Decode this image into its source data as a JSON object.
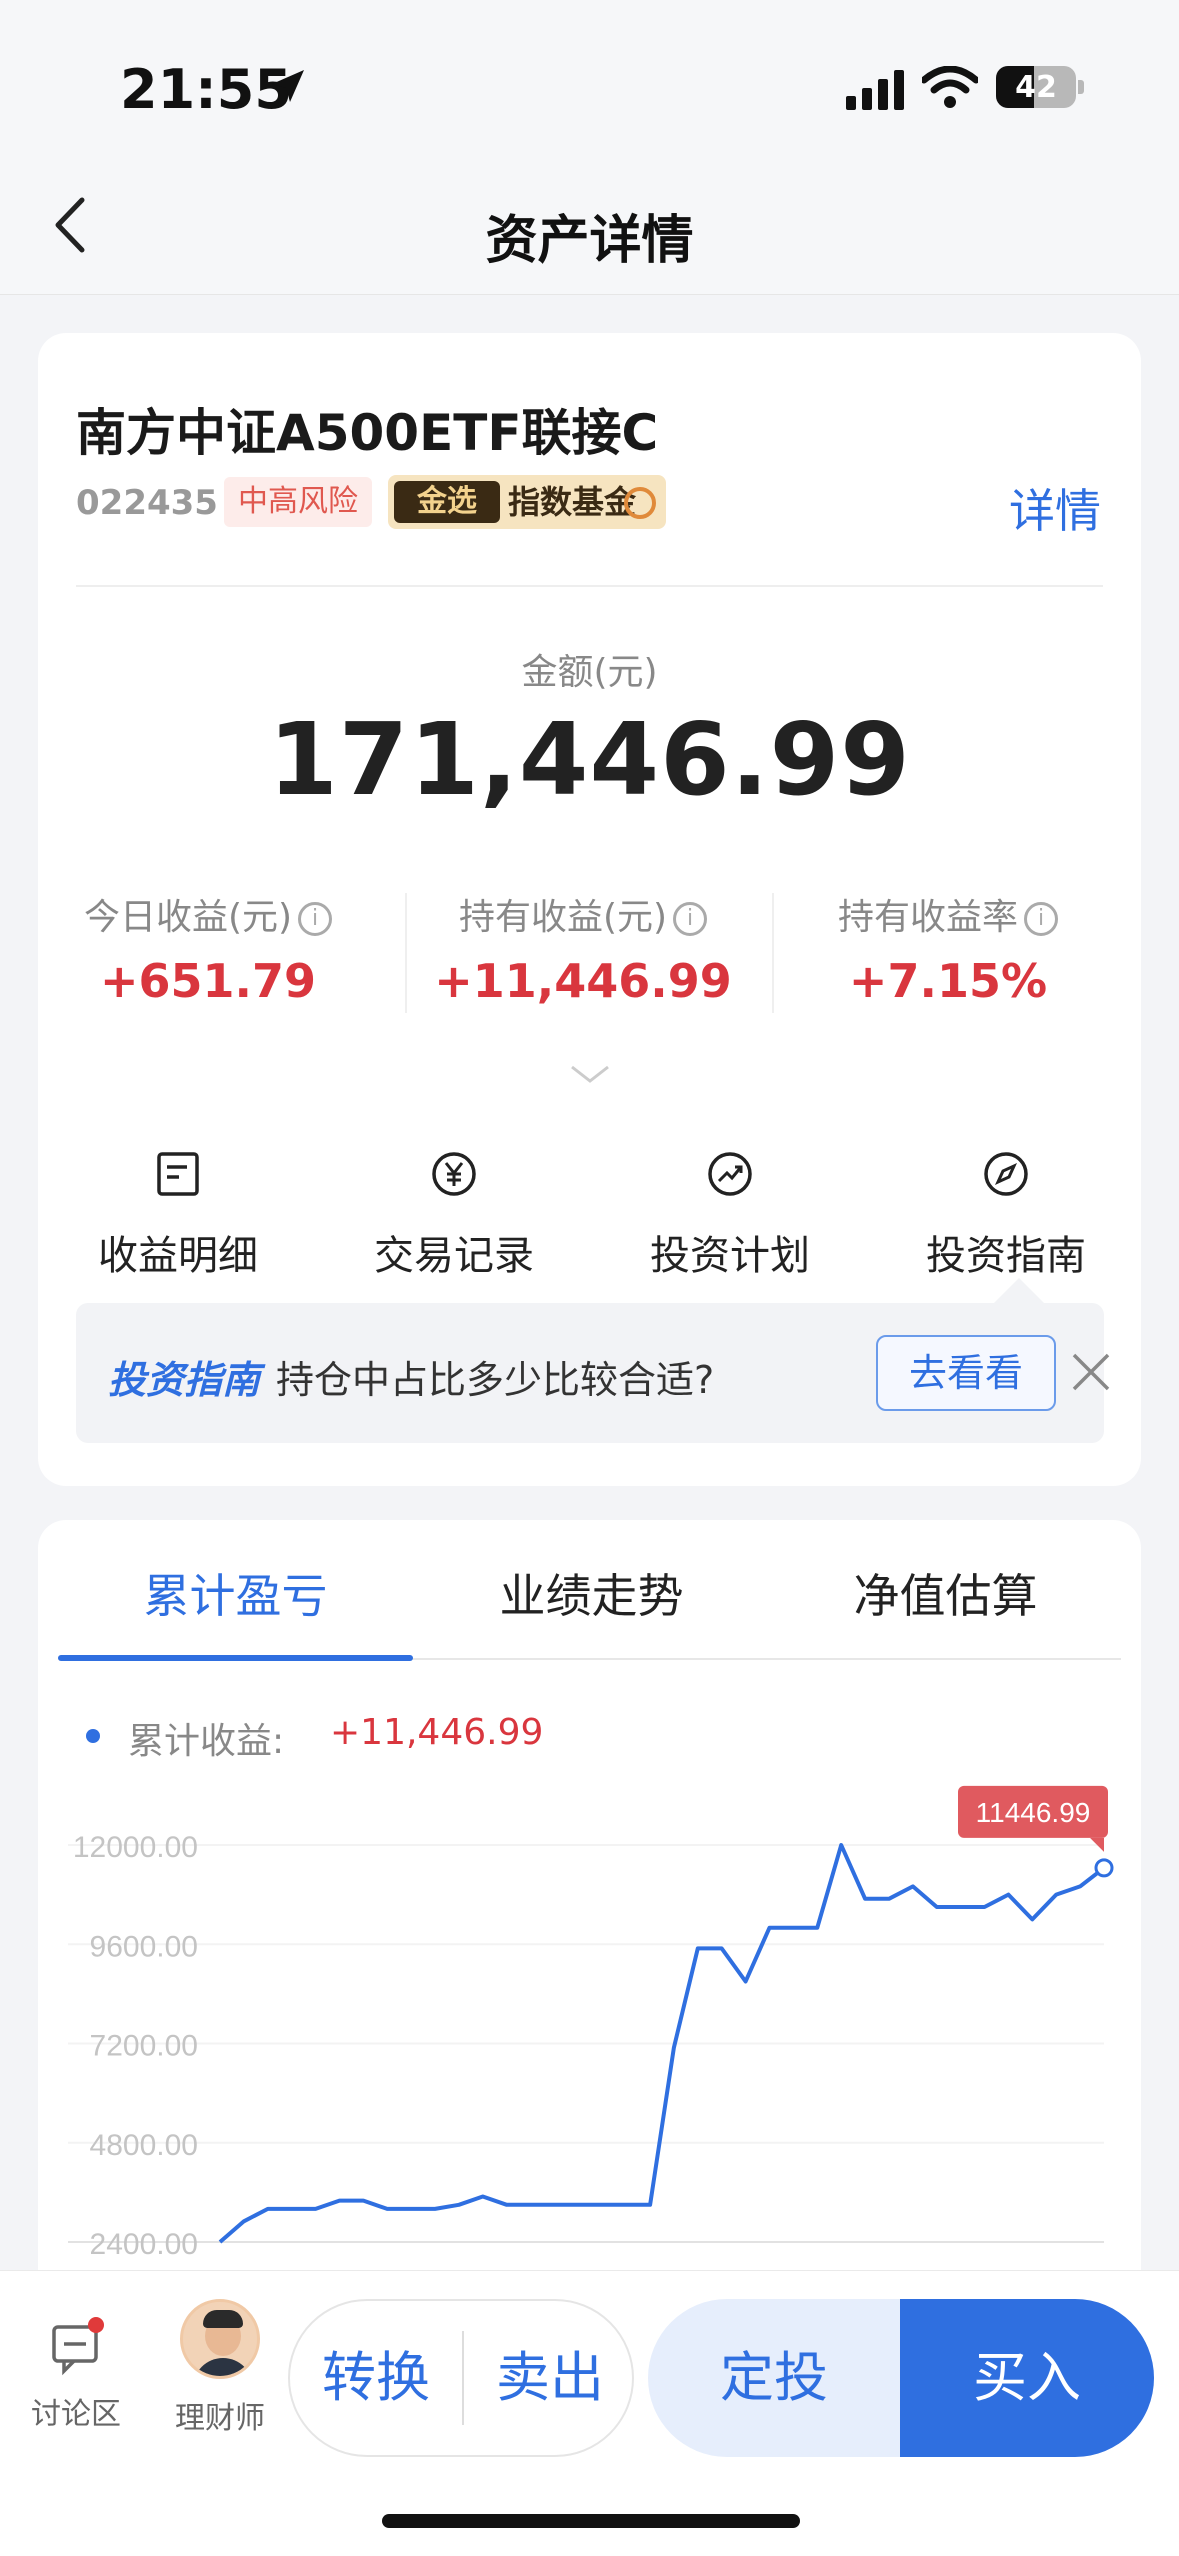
{
  "status_bar": {
    "time": "21:55",
    "battery": "42"
  },
  "nav": {
    "title": "资产详情"
  },
  "fund": {
    "name": "南方中证A500ETF联接C",
    "code": "022435",
    "risk_tag": "中高风险",
    "gold_tag_strong": "金选",
    "gold_tag_text": "指数基金",
    "detail_link": "详情"
  },
  "amount": {
    "label": "金额(元)",
    "value": "171,446.99"
  },
  "stats": [
    {
      "label": "今日收益(元)",
      "value": "+651.79"
    },
    {
      "label": "持有收益(元)",
      "value": "+11,446.99"
    },
    {
      "label": "持有收益率",
      "value": "+7.15%"
    }
  ],
  "quick_actions": [
    {
      "label": "收益明细",
      "icon": "document-icon"
    },
    {
      "label": "交易记录",
      "icon": "yen-icon"
    },
    {
      "label": "投资计划",
      "icon": "trend-icon"
    },
    {
      "label": "投资指南",
      "icon": "compass-icon"
    }
  ],
  "guide": {
    "brand": "投资指南",
    "text": "持仓中占比多少比较合适?",
    "button": "去看看"
  },
  "tabs": [
    {
      "label": "累计盈亏"
    },
    {
      "label": "业绩走势"
    },
    {
      "label": "净值估算"
    }
  ],
  "legend": {
    "label": "累计收益:",
    "value": "+11,446.99"
  },
  "chart_data": {
    "type": "line",
    "title": "",
    "xlabel": "",
    "ylabel": "",
    "y_ticks": [
      "12000.00",
      "9600.00",
      "7200.00",
      "4800.00",
      "2400.00"
    ],
    "ylim": [
      2400,
      12000
    ],
    "series": [
      {
        "color": "#2f6fe0",
        "values": [
          2400,
          2900,
          3200,
          3200,
          3200,
          3400,
          3400,
          3200,
          3200,
          3200,
          3300,
          3500,
          3300,
          3300,
          3300,
          3300,
          3300,
          3300,
          3300,
          7100,
          9500,
          9500,
          8700,
          10000,
          10000,
          10000,
          12000,
          10700,
          10700,
          11000,
          10500,
          10500,
          10500,
          10800,
          10200,
          10800,
          11000,
          11446.99
        ]
      }
    ],
    "last_value_label": "11446.99",
    "grid": true
  },
  "bottom_bar": {
    "discuss": "讨论区",
    "advisor": "理财师",
    "convert": "转换",
    "sell": "卖出",
    "dca": "定投",
    "buy": "买入"
  },
  "colors": {
    "accent": "#2f6fe0",
    "positive": "#d9363e",
    "risk": "#e0584f"
  }
}
